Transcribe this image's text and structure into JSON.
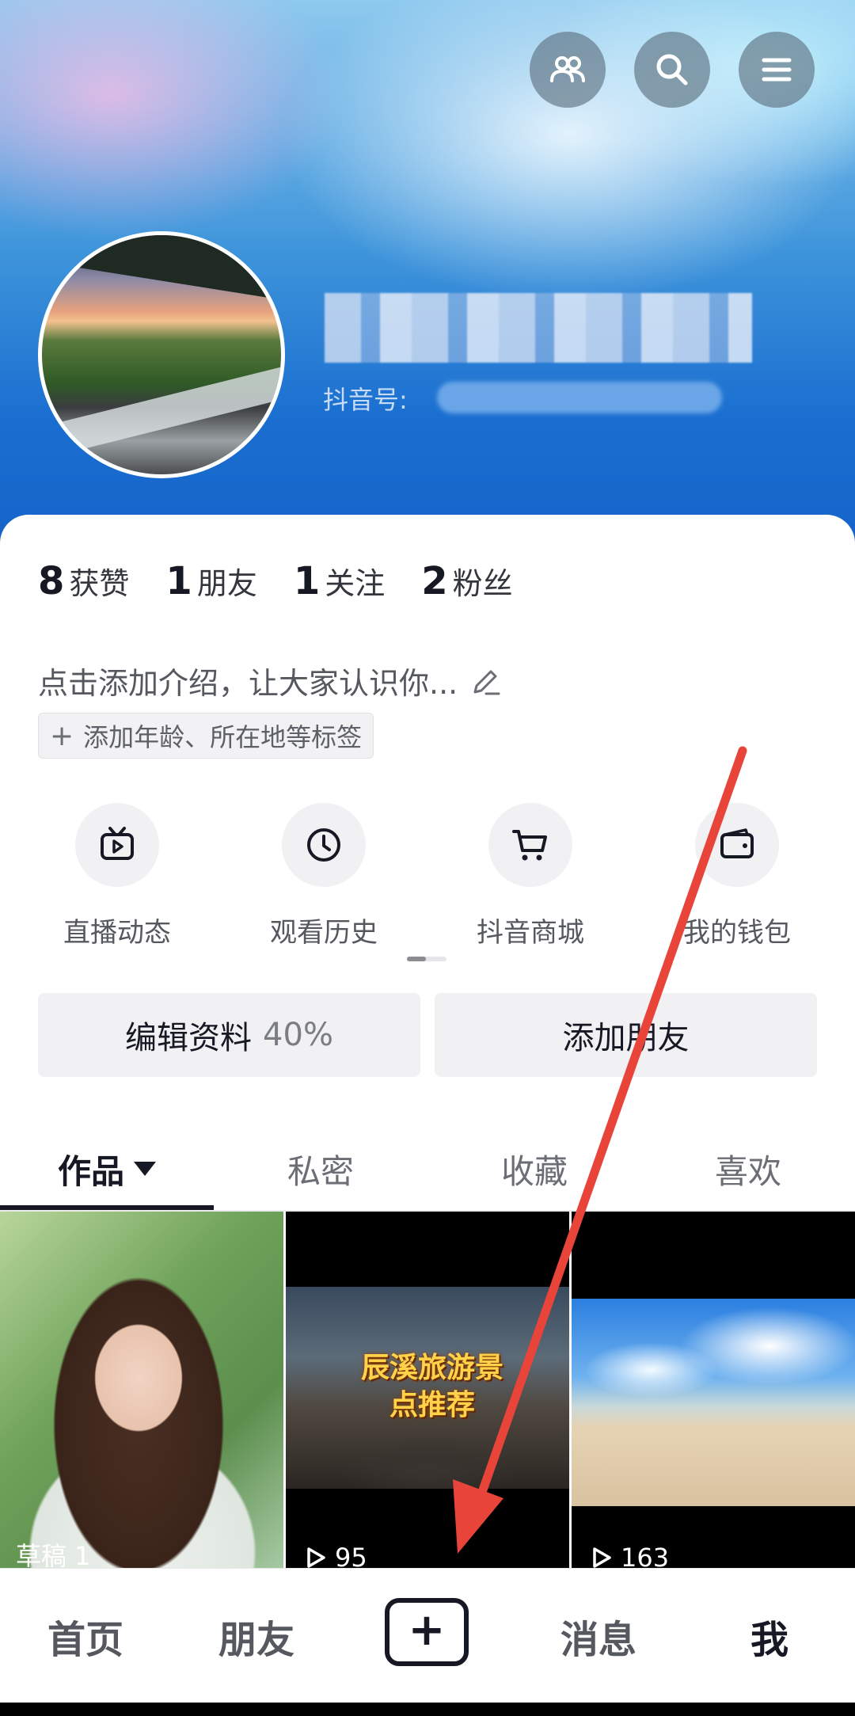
{
  "header": {
    "douyin_id_label": "抖音号:"
  },
  "stats": [
    {
      "count": "8",
      "label": "获赞"
    },
    {
      "count": "1",
      "label": "朋友"
    },
    {
      "count": "1",
      "label": "关注"
    },
    {
      "count": "2",
      "label": "粉丝"
    }
  ],
  "bio": {
    "placeholder": "点击添加介绍，让大家认识你...",
    "tag_chip": "添加年龄、所在地等标签",
    "tag_chip_plus": "+"
  },
  "quick_actions": [
    {
      "label": "直播动态",
      "icon": "live-tv-icon"
    },
    {
      "label": "观看历史",
      "icon": "clock-icon"
    },
    {
      "label": "抖音商城",
      "icon": "cart-icon"
    },
    {
      "label": "我的钱包",
      "icon": "wallet-icon"
    }
  ],
  "buttons": {
    "edit_profile": "编辑资料",
    "edit_profile_pct": "40%",
    "add_friend": "添加朋友"
  },
  "tabs": [
    {
      "label": "作品",
      "active": true
    },
    {
      "label": "私密"
    },
    {
      "label": "收藏"
    },
    {
      "label": "喜欢"
    }
  ],
  "grid": [
    {
      "meta": "草稿 1"
    },
    {
      "title_line1": "辰溪旅游景",
      "title_line2": "点推荐",
      "plays": "95"
    },
    {
      "plays": "163"
    }
  ],
  "bottom_nav": {
    "home": "首页",
    "friends": "朋友",
    "publish": "+",
    "messages": "消息",
    "me": "我"
  },
  "colors": {
    "annotation_arrow": "#e8443a",
    "primary_text": "#161823"
  }
}
